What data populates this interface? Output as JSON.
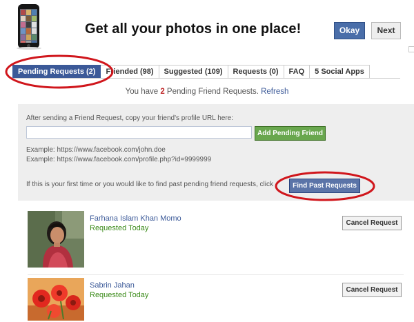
{
  "banner": {
    "headline": "Get all your photos in one place!",
    "okay_label": "Okay",
    "next_label": "Next",
    "phone_thumbnail_colors": [
      "#b04a4a",
      "#d8b26a",
      "#4f7fb0",
      "#e2d0c0",
      "#7a5a3a",
      "#9fb96a",
      "#c26d8f",
      "#3d3d3d",
      "#e0e0e0",
      "#6f93c4",
      "#b86a3c",
      "#dcdcdc",
      "#8b6b9b",
      "#cfa35a",
      "#5a8a6a",
      "#d46a6a",
      "#a0a0a0",
      "#476c9e"
    ]
  },
  "tabs": [
    {
      "label": "Pending Requests (2)",
      "active": true
    },
    {
      "label": "Friended (98)",
      "active": false
    },
    {
      "label": "Suggested (109)",
      "active": false
    },
    {
      "label": "Requests (0)",
      "active": false
    },
    {
      "label": "FAQ",
      "active": false
    },
    {
      "label": "5 Social Apps",
      "active": false
    }
  ],
  "status": {
    "prefix": "You have ",
    "count": "2",
    "suffix": " Pending Friend Requests.",
    "refresh_label": "Refresh"
  },
  "add_panel": {
    "instruction": "After sending a Friend Request, copy your friend's profile URL here:",
    "url_value": "",
    "add_button_label": "Add Pending Friend",
    "example_1": "Example: https://www.facebook.com/john.doe",
    "example_2": "Example: https://www.facebook.com/profile.php?id=9999999",
    "find_text": "If this is your first time or you would like to find past pending friend requests, click",
    "find_button_label": "Find Past Requests"
  },
  "requests": [
    {
      "name": "Farhana Islam Khan Momo",
      "status": "Requested Today",
      "cancel_label": "Cancel Request"
    },
    {
      "name": "Sabrin Jahan",
      "status": "Requested Today",
      "cancel_label": "Cancel Request"
    }
  ],
  "colors": {
    "facebook_blue": "#3b5998",
    "highlight_red": "#d0161c",
    "add_green": "#69a74e",
    "requested_green": "#3a8a18",
    "panel_grey": "#eeeeee"
  }
}
